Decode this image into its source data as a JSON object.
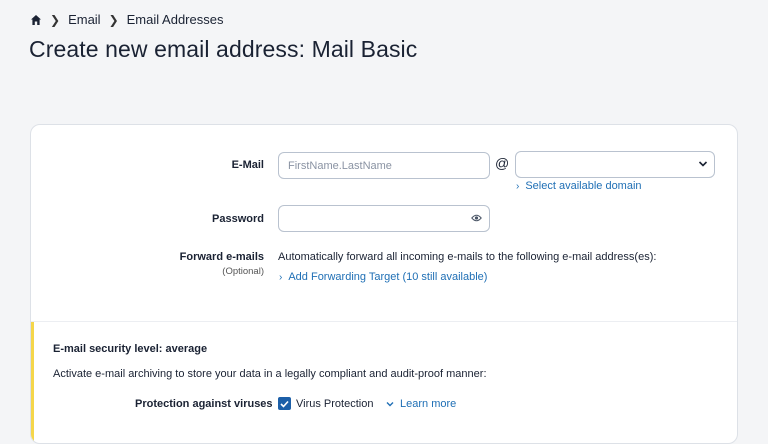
{
  "breadcrumb": {
    "items": [
      "Email",
      "Email Addresses"
    ]
  },
  "page": {
    "title": "Create new email address: Mail Basic"
  },
  "form": {
    "email_label": "E-Mail",
    "email_placeholder": "FirstName.LastName",
    "at_symbol": "@",
    "domain_value": "",
    "select_domain_link": "Select available domain",
    "password_label": "Password",
    "password_value": "",
    "forward_label": "Forward e-mails",
    "forward_optional": "(Optional)",
    "forward_description": "Automatically forward all incoming e-mails to the following e-mail address(es):",
    "add_forwarding_link": "Add Forwarding Target (10 still available)"
  },
  "security": {
    "heading": "E-mail security level: average",
    "description": "Activate e-mail archiving to store your data in a legally compliant and audit-proof manner:",
    "virus_label": "Protection against viruses",
    "virus_checkbox_label": "Virus Protection",
    "virus_checked": true,
    "learn_more": "Learn more"
  },
  "colors": {
    "accent": "#1c5fa8",
    "link": "#1f6fb5",
    "warning_bar": "#f5d64a"
  }
}
